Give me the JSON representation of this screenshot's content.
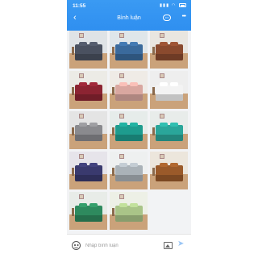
{
  "status": {
    "time": "11:55",
    "signal": "▮▮▮",
    "wifi": "◠"
  },
  "header": {
    "title": "Bình luận",
    "back_icon": "chevron-left-icon",
    "chat_icon": "chat-bubble-icon",
    "more_icon": "more-dots-icon"
  },
  "photos": [
    {
      "badge": "",
      "wall": "#dfe3e6",
      "bed": "#4a5160"
    },
    {
      "badge": "",
      "wall": "#dfe6ea",
      "bed": "#3a6a9c"
    },
    {
      "badge": "",
      "wall": "#e9e6e0",
      "bed": "#8a4a2e"
    },
    {
      "badge": "",
      "wall": "#ecebe6",
      "bed": "#8c2432"
    },
    {
      "badge": "",
      "wall": "#efebe6",
      "bed": "#d9a7a0"
    },
    {
      "badge": "",
      "wall": "#eeeeee",
      "bed": "#f3f3f3"
    },
    {
      "badge": "",
      "wall": "#e4e4e4",
      "bed": "#8a8a8e"
    },
    {
      "badge": "",
      "wall": "#e6ecea",
      "bed": "#1e9c8e"
    },
    {
      "badge": "",
      "wall": "#e8ecea",
      "bed": "#2aa69a"
    },
    {
      "badge": "",
      "wall": "#e6e4ea",
      "bed": "#3a3a6e"
    },
    {
      "badge": "",
      "wall": "#eef0f0",
      "bed": "#aab2b8"
    },
    {
      "badge": "",
      "wall": "#ece6dc",
      "bed": "#9a5a2a"
    },
    {
      "badge": "",
      "wall": "#e8ece8",
      "bed": "#2e8a5e"
    },
    {
      "badge": "",
      "wall": "#edf0e6",
      "bed": "#a9c488"
    }
  ],
  "composer": {
    "placeholder": "Nhập bình luận"
  },
  "colors": {
    "accent": "#2f8ff0",
    "badge": "#f07a2a"
  }
}
